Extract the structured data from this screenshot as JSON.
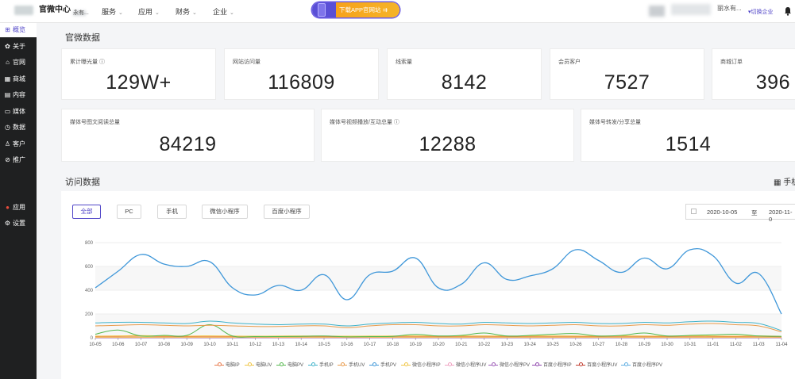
{
  "header": {
    "brand": "官微中心",
    "brand_sub": "永有...",
    "nav": [
      "服务",
      "应用",
      "财务",
      "企业"
    ],
    "banner_text": "下载APP官网站 ⇉",
    "user_name": "丽水有...",
    "switch_label": "▾切换企业",
    "bell_icon": "bell-icon"
  },
  "sidebar": {
    "items": [
      {
        "label": "概览",
        "icon": "overview-icon",
        "glyph": "⊞"
      },
      {
        "label": "关于",
        "icon": "gear-icon",
        "glyph": "✿"
      },
      {
        "label": "官网",
        "icon": "home-icon",
        "glyph": "⌂"
      },
      {
        "label": "商城",
        "icon": "shop-icon",
        "glyph": "▦"
      },
      {
        "label": "内容",
        "icon": "content-icon",
        "glyph": "▤"
      },
      {
        "label": "媒体",
        "icon": "media-icon",
        "glyph": "▭"
      },
      {
        "label": "数据",
        "icon": "data-icon",
        "glyph": "◷"
      },
      {
        "label": "客户",
        "icon": "user-icon",
        "glyph": "♙"
      },
      {
        "label": "推广",
        "icon": "link-icon",
        "glyph": "⊘"
      },
      {
        "label": "应用",
        "icon": "apps-icon",
        "glyph": "●"
      },
      {
        "label": "设置",
        "icon": "settings-icon",
        "glyph": "⚙"
      }
    ]
  },
  "stats_title": "官微数据",
  "stats_row1": [
    {
      "label": "累计曝光量 ⓘ",
      "value": "129W+"
    },
    {
      "label": "网站访问量",
      "value": "116809"
    },
    {
      "label": "线索量",
      "value": "8142"
    },
    {
      "label": "会员客户",
      "value": "7527"
    },
    {
      "label": "商城订单",
      "value": "396"
    }
  ],
  "stats_row2": [
    {
      "label": "媒体号图文阅读总量",
      "value": "84219"
    },
    {
      "label": "媒体号视频播放/互动总量 ⓘ",
      "value": "12288"
    },
    {
      "label": "媒体号转发/分享总量",
      "value": "1514"
    }
  ],
  "visits_title": "访问数据",
  "device_label": "手机",
  "filters": [
    "全部",
    "PC",
    "手机",
    "微信小程序",
    "百度小程序"
  ],
  "date_range": {
    "start": "2020-10-05",
    "sep": "至",
    "end": "2020-11-0"
  },
  "chart_data": {
    "type": "line",
    "x": [
      "10-05",
      "10-06",
      "10-07",
      "10-08",
      "10-09",
      "10-10",
      "10-11",
      "10-12",
      "10-13",
      "10-14",
      "10-15",
      "10-16",
      "10-17",
      "10-18",
      "10-19",
      "10-20",
      "10-21",
      "10-22",
      "10-23",
      "10-24",
      "10-25",
      "10-26",
      "10-27",
      "10-28",
      "10-29",
      "10-30",
      "10-31",
      "11-01",
      "11-02",
      "11-03",
      "11-04"
    ],
    "yticks": [
      0,
      200,
      400,
      600,
      800
    ],
    "ylim": [
      0,
      800
    ],
    "series": [
      {
        "name": "电脑IP",
        "color": "#e8794a",
        "values": [
          10,
          12,
          14,
          11,
          10,
          12,
          10,
          9,
          10,
          11,
          10,
          9,
          10,
          11,
          12,
          10,
          11,
          12,
          10,
          11,
          12,
          11,
          10,
          12,
          11,
          10,
          12,
          11,
          10,
          12,
          8
        ]
      },
      {
        "name": "电脑UV",
        "color": "#f0c543",
        "values": [
          14,
          16,
          18,
          15,
          14,
          16,
          14,
          13,
          14,
          15,
          14,
          13,
          14,
          15,
          16,
          14,
          15,
          16,
          14,
          15,
          16,
          15,
          14,
          16,
          15,
          14,
          16,
          15,
          14,
          16,
          12
        ]
      },
      {
        "name": "电脑PV",
        "color": "#55b84e",
        "values": [
          30,
          65,
          15,
          20,
          20,
          110,
          15,
          10,
          10,
          12,
          15,
          8,
          10,
          12,
          28,
          15,
          20,
          40,
          15,
          20,
          30,
          35,
          15,
          20,
          40,
          15,
          20,
          25,
          30,
          15,
          12
        ]
      },
      {
        "name": "手机IP",
        "color": "#3fb2c9",
        "values": [
          125,
          130,
          130,
          125,
          120,
          140,
          125,
          115,
          110,
          115,
          115,
          100,
          115,
          125,
          130,
          120,
          115,
          130,
          125,
          120,
          125,
          130,
          120,
          120,
          130,
          125,
          135,
          140,
          130,
          120,
          60
        ]
      },
      {
        "name": "手机UV",
        "color": "#e89a4a",
        "values": [
          100,
          105,
          110,
          105,
          100,
          105,
          100,
          95,
          95,
          100,
          100,
          85,
          100,
          110,
          110,
          100,
          100,
          110,
          105,
          100,
          105,
          110,
          100,
          100,
          110,
          105,
          115,
          120,
          110,
          100,
          50
        ]
      },
      {
        "name": "手机PV",
        "color": "#3f97d9",
        "values": [
          420,
          560,
          700,
          620,
          600,
          640,
          420,
          360,
          440,
          400,
          530,
          320,
          530,
          560,
          670,
          420,
          450,
          630,
          490,
          520,
          580,
          740,
          650,
          550,
          670,
          580,
          740,
          690,
          460,
          540,
          200
        ]
      },
      {
        "name": "微信小程序IP",
        "color": "#f0c543",
        "values": [
          5,
          5,
          5,
          5,
          5,
          5,
          5,
          5,
          5,
          5,
          5,
          5,
          5,
          5,
          5,
          5,
          5,
          5,
          5,
          5,
          5,
          5,
          5,
          5,
          5,
          5,
          5,
          5,
          5,
          5,
          5
        ]
      },
      {
        "name": "微信小程序UV",
        "color": "#f0a0c0",
        "values": [
          3,
          3,
          3,
          3,
          3,
          3,
          3,
          3,
          3,
          3,
          3,
          3,
          3,
          3,
          3,
          3,
          3,
          3,
          3,
          3,
          3,
          3,
          3,
          3,
          3,
          3,
          3,
          3,
          3,
          3,
          3
        ]
      },
      {
        "name": "微信小程序PV",
        "color": "#9b59b6",
        "values": [
          2,
          2,
          2,
          2,
          2,
          2,
          2,
          2,
          2,
          2,
          2,
          2,
          2,
          2,
          2,
          2,
          2,
          2,
          2,
          2,
          2,
          2,
          2,
          2,
          2,
          2,
          2,
          2,
          2,
          2,
          2
        ]
      },
      {
        "name": "百度小程序IP",
        "color": "#8e44ad",
        "values": [
          1,
          1,
          1,
          1,
          1,
          1,
          1,
          1,
          1,
          1,
          1,
          1,
          1,
          1,
          1,
          1,
          1,
          1,
          1,
          1,
          1,
          1,
          1,
          1,
          1,
          1,
          1,
          1,
          1,
          1,
          1
        ]
      },
      {
        "name": "百度小程序UV",
        "color": "#c0392b",
        "values": [
          1,
          1,
          1,
          1,
          1,
          1,
          1,
          1,
          1,
          1,
          1,
          1,
          1,
          1,
          1,
          1,
          1,
          1,
          1,
          1,
          1,
          1,
          1,
          1,
          1,
          1,
          1,
          1,
          1,
          1,
          1
        ]
      },
      {
        "name": "百度小程序PV",
        "color": "#5dade2",
        "values": [
          0,
          0,
          0,
          0,
          0,
          0,
          0,
          0,
          0,
          0,
          0,
          0,
          0,
          0,
          0,
          0,
          0,
          0,
          0,
          0,
          0,
          0,
          0,
          0,
          0,
          0,
          0,
          0,
          0,
          0,
          0
        ]
      }
    ]
  }
}
